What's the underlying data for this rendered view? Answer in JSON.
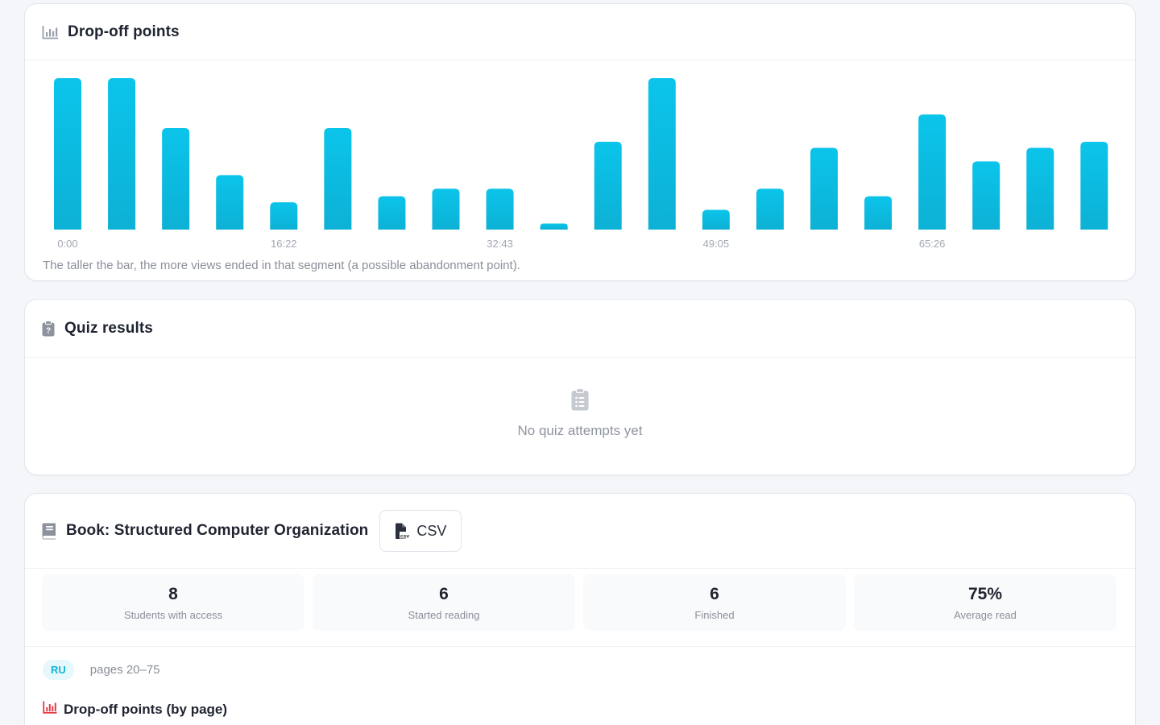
{
  "colors": {
    "accent": "#0bc3e8",
    "accent_dark": "#0cb3d6",
    "muted_text": "#8a8f99",
    "danger_icon": "#e53945"
  },
  "dropoff": {
    "title": "Drop-off points",
    "icon": "bar-chart-icon",
    "caption": "The taller the bar, the more views ended in that segment (a possible abandonment point).",
    "chart_data": {
      "type": "bar",
      "values": [
        100,
        100,
        67,
        36,
        18,
        67,
        22,
        27,
        27,
        4,
        58,
        100,
        13,
        27,
        54,
        22,
        76,
        45,
        54,
        58
      ],
      "tick_labels": [
        "0:00",
        "16:22",
        "32:43",
        "49:05",
        "65:26"
      ],
      "tick_indices": [
        0,
        4,
        8,
        12,
        16
      ],
      "ylim": [
        0,
        100
      ],
      "grid": false
    }
  },
  "quiz": {
    "title": "Quiz results",
    "icon": "clipboard-question-icon",
    "empty_icon": "clipboard-list-icon",
    "empty_text": "No quiz attempts yet"
  },
  "book": {
    "title": "Book: Structured Computer Organization",
    "icon": "book-icon",
    "csv_label": "CSV",
    "csv_icon": "csv-file-icon",
    "stats": [
      {
        "value": "8",
        "label": "Students with access"
      },
      {
        "value": "6",
        "label": "Started reading"
      },
      {
        "value": "6",
        "label": "Finished"
      },
      {
        "value": "75%",
        "label": "Average read"
      }
    ],
    "language_badge": "RU",
    "pages_text": "pages 20–75",
    "subsection_title": "Drop-off points (by page)",
    "subsection_icon": "bar-chart-icon"
  }
}
